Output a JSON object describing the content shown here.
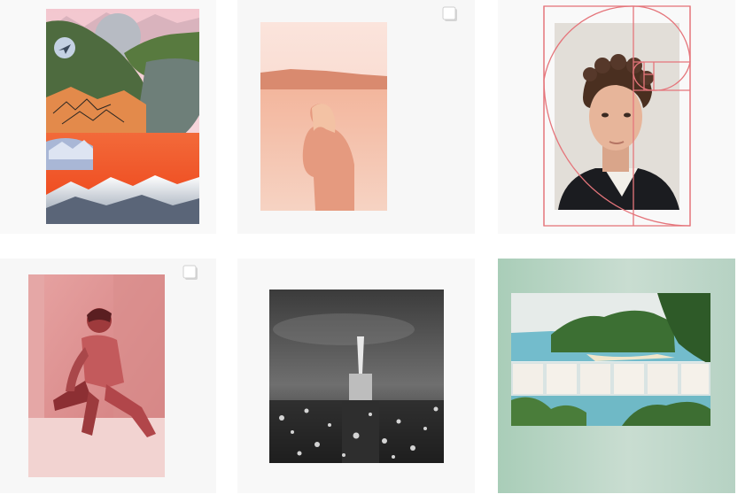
{
  "grid": {
    "posts": [
      {
        "id": "post-1",
        "subject": "landscape-collage",
        "multiple": false,
        "background": "#f9f9f9"
      },
      {
        "id": "post-2",
        "subject": "pink-lake-portrait",
        "multiple": true,
        "background": "#f7f7f7"
      },
      {
        "id": "post-3",
        "subject": "golden-ratio-portrait",
        "multiple": false,
        "background": "#f9f9f9"
      },
      {
        "id": "post-4",
        "subject": "red-duotone-seated-man",
        "multiple": true,
        "background": "#f7f7f7"
      },
      {
        "id": "post-5",
        "subject": "night-city-bw",
        "multiple": false,
        "background": "#f8f8f8"
      },
      {
        "id": "post-6",
        "subject": "beach-cove-mint",
        "multiple": false,
        "background": "#bdd7c8"
      }
    ]
  },
  "icons": {
    "multi_post": "multiple-photos-icon",
    "collage_badge": "paper-plane-icon"
  },
  "colors": {
    "page_background": "#ffffff",
    "golden_spiral": "#e5757b",
    "duotone_red": "#c9575b",
    "peach": "#f1b8a0",
    "mint": "#bdd7c8"
  }
}
